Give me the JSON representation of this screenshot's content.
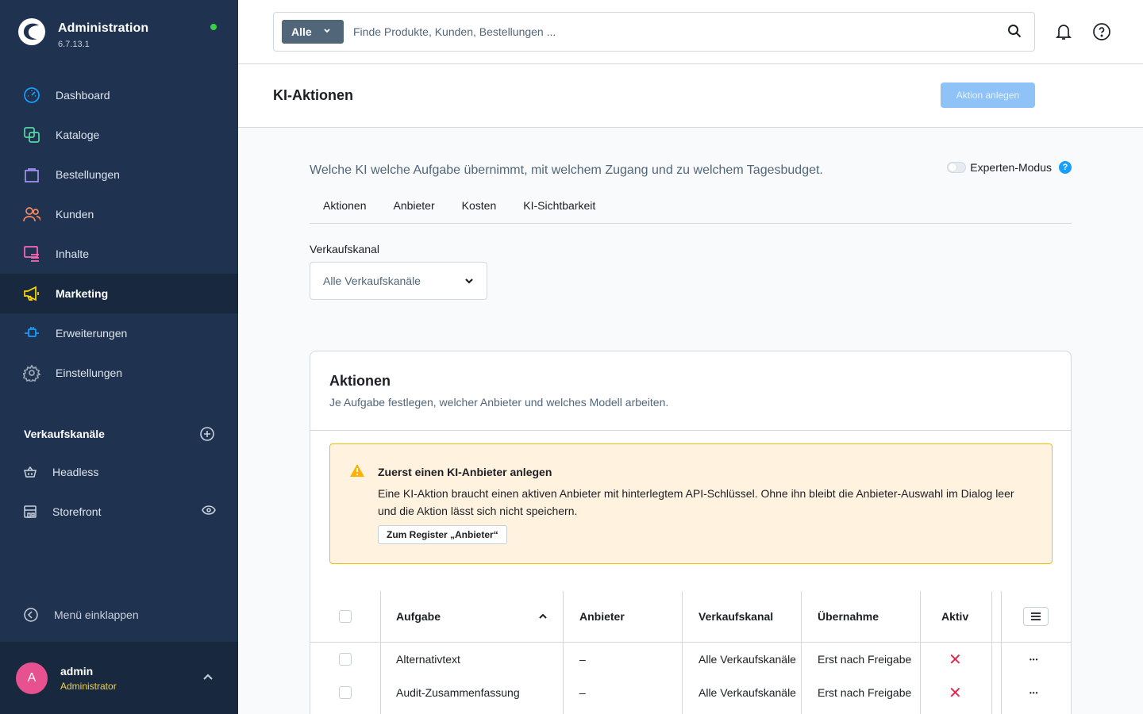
{
  "sidebar": {
    "brand_title": "Administration",
    "brand_version": "6.7.13.1",
    "items": [
      {
        "label": "Dashboard",
        "icon": "gauge-icon",
        "color": "#189eff"
      },
      {
        "label": "Kataloge",
        "icon": "catalog-icon",
        "color": "#57d9a3"
      },
      {
        "label": "Bestellungen",
        "icon": "shopping-bag-icon",
        "color": "#a092f0"
      },
      {
        "label": "Kunden",
        "icon": "users-icon",
        "color": "#f88962"
      },
      {
        "label": "Inhalte",
        "icon": "content-icon",
        "color": "#ff68b4"
      },
      {
        "label": "Marketing",
        "icon": "megaphone-icon",
        "color": "#ffd700",
        "active": true
      },
      {
        "label": "Erweiterungen",
        "icon": "plug-icon",
        "color": "#189eff"
      },
      {
        "label": "Einstellungen",
        "icon": "gear-icon",
        "color": "#9aa8b5"
      }
    ],
    "sales_channels_title": "Verkaufskanäle",
    "sales_channels": [
      {
        "label": "Headless",
        "icon": "basket-icon"
      },
      {
        "label": "Storefront",
        "icon": "storefront-icon"
      }
    ],
    "collapse_label": "Menü einklappen",
    "user": {
      "initial": "A",
      "name": "admin",
      "role": "Administrator"
    }
  },
  "topbar": {
    "search_type": "Alle",
    "search_placeholder": "Finde Produkte, Kunden, Bestellungen ..."
  },
  "header": {
    "title": "KI-Aktionen",
    "create_button": "Aktion anlegen"
  },
  "content": {
    "intro": "Welche KI welche Aufgabe übernimmt, mit welchem Zugang und zu welchem Tagesbudget.",
    "expert_mode_label": "Experten-Modus",
    "help_badge": "?",
    "tabs": [
      "Aktionen",
      "Anbieter",
      "Kosten",
      "KI-Sichtbarkeit"
    ],
    "sales_channel_label": "Verkaufskanal",
    "sales_channel_value": "Alle Verkaufskanäle"
  },
  "card": {
    "title": "Aktionen",
    "subtitle": "Je Aufgabe festlegen, welcher Anbieter und welches Modell arbeiten.",
    "alert": {
      "title": "Zuerst einen KI-Anbieter anlegen",
      "text": "Eine KI-Aktion braucht einen aktiven Anbieter mit hinterlegtem API-Schlüssel. Ohne ihn bleibt die Anbieter-Auswahl im Dialog leer und die Aktion lässt sich nicht speichern.",
      "button": "Zum Register „Anbieter“"
    },
    "grid": {
      "columns": [
        "Aufgabe",
        "Anbieter",
        "Verkaufskanal",
        "Übernahme",
        "Aktiv"
      ],
      "rows": [
        {
          "task": "Alternativtext",
          "provider": "–",
          "channel": "Alle Verkaufskanäle",
          "takeover": "Erst nach Freigabe",
          "active": "✕"
        },
        {
          "task": "Audit-Zusammenfassung",
          "provider": "–",
          "channel": "Alle Verkaufskanäle",
          "takeover": "Erst nach Freigabe",
          "active": "✕"
        }
      ],
      "row_menu": "•••"
    }
  },
  "colors": {
    "sidebar_bg": "#1f3250",
    "sidebar_active": "#18283f",
    "primary_disabled": "#8fc3f7",
    "alert_bg": "#fff3e0",
    "alert_border": "#f0c000",
    "inactive_red": "#de294c",
    "status_dot": "#37d046"
  }
}
